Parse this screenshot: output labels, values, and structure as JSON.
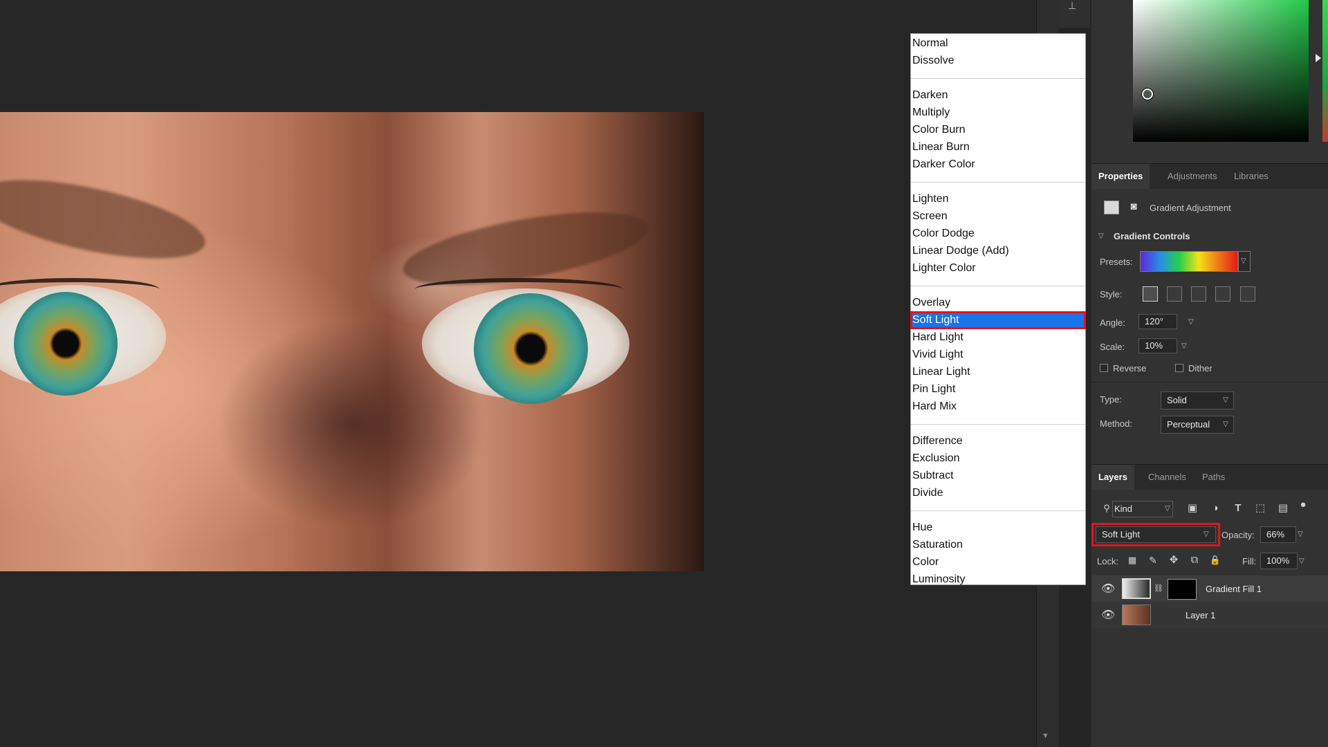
{
  "blend_menu": {
    "groups": [
      [
        "Normal",
        "Dissolve"
      ],
      [
        "Darken",
        "Multiply",
        "Color Burn",
        "Linear Burn",
        "Darker Color"
      ],
      [
        "Lighten",
        "Screen",
        "Color Dodge",
        "Linear Dodge (Add)",
        "Lighter Color"
      ],
      [
        "Overlay",
        "Soft Light",
        "Hard Light",
        "Vivid Light",
        "Linear Light",
        "Pin Light",
        "Hard Mix"
      ],
      [
        "Difference",
        "Exclusion",
        "Subtract",
        "Divide"
      ],
      [
        "Hue",
        "Saturation",
        "Color",
        "Luminosity"
      ]
    ],
    "selected": "Soft Light"
  },
  "properties_tabs": [
    "Properties",
    "Adjustments",
    "Libraries"
  ],
  "properties": {
    "adjustment_title": "Gradient Adjustment",
    "section": "Gradient Controls",
    "presets_label": "Presets:",
    "style_label": "Style:",
    "angle_label": "Angle:",
    "angle_value": "120°",
    "scale_label": "Scale:",
    "scale_value": "10%",
    "reverse_label": "Reverse",
    "dither_label": "Dither",
    "type_label": "Type:",
    "type_value": "Solid",
    "method_label": "Method:",
    "method_value": "Perceptual"
  },
  "layers_tabs": [
    "Layers",
    "Channels",
    "Paths"
  ],
  "layers_panel": {
    "filter_label": "Kind",
    "blend_mode": "Soft Light",
    "opacity_label": "Opacity:",
    "opacity_value": "66%",
    "lock_label": "Lock:",
    "fill_label": "Fill:",
    "fill_value": "100%",
    "layers": [
      {
        "name": "Gradient Fill 1"
      },
      {
        "name": "Layer 1"
      }
    ]
  },
  "colors": {
    "selection_blue": "#1a73e8",
    "highlight_red": "#e3141b"
  }
}
